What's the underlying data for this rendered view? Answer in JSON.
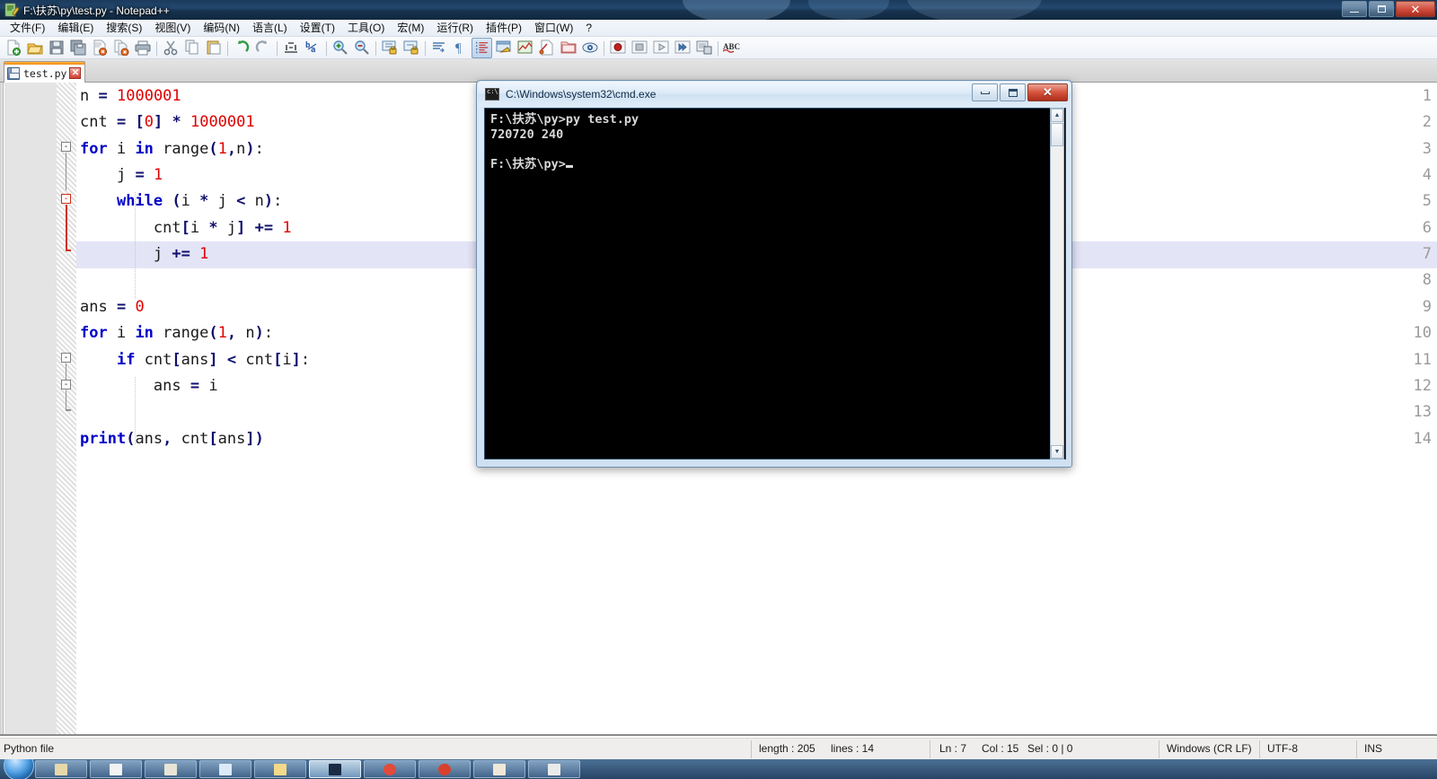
{
  "window": {
    "title": "F:\\扶苏\\py\\test.py - Notepad++",
    "icon": "notepad-plus-plus-icon",
    "minimize_label": "─",
    "maximize_label": "❐",
    "close_label": "✕"
  },
  "menu": {
    "items": [
      {
        "label": "文件(F)",
        "name": "menu-file"
      },
      {
        "label": "编辑(E)",
        "name": "menu-edit"
      },
      {
        "label": "搜索(S)",
        "name": "menu-search"
      },
      {
        "label": "视图(V)",
        "name": "menu-view"
      },
      {
        "label": "编码(N)",
        "name": "menu-encoding"
      },
      {
        "label": "语言(L)",
        "name": "menu-language"
      },
      {
        "label": "设置(T)",
        "name": "menu-settings"
      },
      {
        "label": "工具(O)",
        "name": "menu-tools"
      },
      {
        "label": "宏(M)",
        "name": "menu-macro"
      },
      {
        "label": "运行(R)",
        "name": "menu-run"
      },
      {
        "label": "插件(P)",
        "name": "menu-plugins"
      },
      {
        "label": "窗口(W)",
        "name": "menu-window"
      },
      {
        "label": "?",
        "name": "menu-help"
      }
    ]
  },
  "toolbar": {
    "buttons": [
      {
        "icon": "new-file-icon"
      },
      {
        "icon": "open-file-icon"
      },
      {
        "icon": "save-icon"
      },
      {
        "icon": "save-all-icon"
      },
      {
        "icon": "close-file-icon"
      },
      {
        "icon": "close-all-icon"
      },
      {
        "icon": "print-icon"
      },
      {
        "icon": "separator"
      },
      {
        "icon": "cut-icon"
      },
      {
        "icon": "copy-icon"
      },
      {
        "icon": "paste-icon"
      },
      {
        "icon": "separator"
      },
      {
        "icon": "undo-icon"
      },
      {
        "icon": "redo-icon"
      },
      {
        "icon": "separator"
      },
      {
        "icon": "find-icon"
      },
      {
        "icon": "replace-icon"
      },
      {
        "icon": "separator"
      },
      {
        "icon": "zoom-in-icon"
      },
      {
        "icon": "zoom-out-icon"
      },
      {
        "icon": "separator"
      },
      {
        "icon": "sync-vertical-scroll-icon"
      },
      {
        "icon": "sync-horizontal-scroll-icon"
      },
      {
        "icon": "separator"
      },
      {
        "icon": "word-wrap-icon"
      },
      {
        "icon": "show-all-characters-icon"
      },
      {
        "icon": "indent-guide-icon",
        "state": "pressed"
      },
      {
        "icon": "user-defined-dialog-icon"
      },
      {
        "icon": "document-map-icon"
      },
      {
        "icon": "function-list-icon"
      },
      {
        "icon": "folder-as-workspace-icon"
      },
      {
        "icon": "monitoring-icon"
      },
      {
        "icon": "separator"
      },
      {
        "icon": "record-macro-icon"
      },
      {
        "icon": "stop-recording-icon"
      },
      {
        "icon": "play-macro-icon"
      },
      {
        "icon": "run-macro-multiple-icon"
      },
      {
        "icon": "save-macro-icon"
      },
      {
        "icon": "separator"
      },
      {
        "icon": "spell-check-icon"
      }
    ]
  },
  "tabs": [
    {
      "label": "test.py",
      "icon": "saved-file-icon",
      "close": "✕",
      "active": true
    }
  ],
  "editor": {
    "lines": [
      {
        "n": "1",
        "indent": 0,
        "tokens": [
          {
            "t": "n",
            "c": "plain"
          },
          {
            "t": " ",
            "c": "plain"
          },
          {
            "t": "=",
            "c": "op"
          },
          {
            "t": " ",
            "c": "plain"
          },
          {
            "t": "1000001",
            "c": "num"
          }
        ]
      },
      {
        "n": "2",
        "indent": 0,
        "tokens": [
          {
            "t": "cnt",
            "c": "plain"
          },
          {
            "t": " ",
            "c": "plain"
          },
          {
            "t": "=",
            "c": "op"
          },
          {
            "t": " ",
            "c": "plain"
          },
          {
            "t": "[",
            "c": "brk"
          },
          {
            "t": "0",
            "c": "num"
          },
          {
            "t": "]",
            "c": "brk"
          },
          {
            "t": " ",
            "c": "plain"
          },
          {
            "t": "*",
            "c": "op"
          },
          {
            "t": " ",
            "c": "plain"
          },
          {
            "t": "1000001",
            "c": "num"
          }
        ]
      },
      {
        "n": "3",
        "indent": 0,
        "tokens": [
          {
            "t": "for",
            "c": "kw"
          },
          {
            "t": " i ",
            "c": "plain"
          },
          {
            "t": "in",
            "c": "kw"
          },
          {
            "t": " range",
            "c": "plain"
          },
          {
            "t": "(",
            "c": "brk"
          },
          {
            "t": "1",
            "c": "num"
          },
          {
            "t": ",",
            "c": "brk"
          },
          {
            "t": "n",
            "c": "plain"
          },
          {
            "t": ")",
            "c": "brk"
          },
          {
            "t": ":",
            "c": "plain"
          }
        ]
      },
      {
        "n": "4",
        "indent": 4,
        "tokens": [
          {
            "t": "j",
            "c": "plain"
          },
          {
            "t": " ",
            "c": "plain"
          },
          {
            "t": "=",
            "c": "op"
          },
          {
            "t": " ",
            "c": "plain"
          },
          {
            "t": "1",
            "c": "num"
          }
        ]
      },
      {
        "n": "5",
        "indent": 4,
        "tokens": [
          {
            "t": "while",
            "c": "kw"
          },
          {
            "t": " ",
            "c": "plain"
          },
          {
            "t": "(",
            "c": "brk"
          },
          {
            "t": "i ",
            "c": "plain"
          },
          {
            "t": "*",
            "c": "op"
          },
          {
            "t": " j ",
            "c": "plain"
          },
          {
            "t": "<",
            "c": "op"
          },
          {
            "t": " n",
            "c": "plain"
          },
          {
            "t": ")",
            "c": "brk"
          },
          {
            "t": ":",
            "c": "plain"
          }
        ]
      },
      {
        "n": "6",
        "indent": 8,
        "tokens": [
          {
            "t": "cnt",
            "c": "plain"
          },
          {
            "t": "[",
            "c": "brk"
          },
          {
            "t": "i ",
            "c": "plain"
          },
          {
            "t": "*",
            "c": "op"
          },
          {
            "t": " j",
            "c": "plain"
          },
          {
            "t": "]",
            "c": "brk"
          },
          {
            "t": " ",
            "c": "plain"
          },
          {
            "t": "+=",
            "c": "op"
          },
          {
            "t": " ",
            "c": "plain"
          },
          {
            "t": "1",
            "c": "num"
          }
        ]
      },
      {
        "n": "7",
        "indent": 8,
        "highlight": true,
        "tokens": [
          {
            "t": "j",
            "c": "plain"
          },
          {
            "t": " ",
            "c": "plain"
          },
          {
            "t": "+=",
            "c": "op"
          },
          {
            "t": " ",
            "c": "plain"
          },
          {
            "t": "1",
            "c": "num"
          }
        ]
      },
      {
        "n": "8",
        "indent": 0,
        "tokens": []
      },
      {
        "n": "9",
        "indent": 0,
        "tokens": [
          {
            "t": "ans",
            "c": "plain"
          },
          {
            "t": " ",
            "c": "plain"
          },
          {
            "t": "=",
            "c": "op"
          },
          {
            "t": " ",
            "c": "plain"
          },
          {
            "t": "0",
            "c": "num"
          }
        ]
      },
      {
        "n": "10",
        "indent": 0,
        "tokens": [
          {
            "t": "for",
            "c": "kw"
          },
          {
            "t": " i ",
            "c": "plain"
          },
          {
            "t": "in",
            "c": "kw"
          },
          {
            "t": " range",
            "c": "plain"
          },
          {
            "t": "(",
            "c": "brk"
          },
          {
            "t": "1",
            "c": "num"
          },
          {
            "t": ",",
            "c": "brk"
          },
          {
            "t": " n",
            "c": "plain"
          },
          {
            "t": ")",
            "c": "brk"
          },
          {
            "t": ":",
            "c": "plain"
          }
        ]
      },
      {
        "n": "11",
        "indent": 4,
        "tokens": [
          {
            "t": "if",
            "c": "kw"
          },
          {
            "t": " cnt",
            "c": "plain"
          },
          {
            "t": "[",
            "c": "brk"
          },
          {
            "t": "ans",
            "c": "plain"
          },
          {
            "t": "]",
            "c": "brk"
          },
          {
            "t": " ",
            "c": "plain"
          },
          {
            "t": "<",
            "c": "op"
          },
          {
            "t": " cnt",
            "c": "plain"
          },
          {
            "t": "[",
            "c": "brk"
          },
          {
            "t": "i",
            "c": "plain"
          },
          {
            "t": "]",
            "c": "brk"
          },
          {
            "t": ":",
            "c": "plain"
          }
        ]
      },
      {
        "n": "12",
        "indent": 8,
        "tokens": [
          {
            "t": "ans",
            "c": "plain"
          },
          {
            "t": " ",
            "c": "plain"
          },
          {
            "t": "=",
            "c": "op"
          },
          {
            "t": " i",
            "c": "plain"
          }
        ]
      },
      {
        "n": "13",
        "indent": 0,
        "tokens": []
      },
      {
        "n": "14",
        "indent": 0,
        "tokens": [
          {
            "t": "print",
            "c": "fn"
          },
          {
            "t": "(",
            "c": "brk"
          },
          {
            "t": "ans",
            "c": "plain"
          },
          {
            "t": ",",
            "c": "brk"
          },
          {
            "t": " cnt",
            "c": "plain"
          },
          {
            "t": "[",
            "c": "brk"
          },
          {
            "t": "ans",
            "c": "plain"
          },
          {
            "t": "]",
            "c": "brk"
          },
          {
            "t": ")",
            "c": "brk"
          }
        ]
      }
    ],
    "fold_markers": [
      {
        "line": 3,
        "glyph": "-",
        "color": "gray"
      },
      {
        "line": 5,
        "glyph": "-",
        "color": "red"
      },
      {
        "line": 10,
        "glyph": "-",
        "color": "gray"
      },
      {
        "line": 11,
        "glyph": "-",
        "color": "gray"
      }
    ],
    "colors": {
      "keyword": "#0000c8",
      "number": "#e00000",
      "operator": "#10106e",
      "current_line_highlight": "#e4e4f7",
      "line_number": "#9a9a9a",
      "background": "#ffffff"
    }
  },
  "cmd": {
    "title": "C:\\Windows\\system32\\cmd.exe",
    "icon": "cmd-console-icon",
    "minimize_label": "minimize",
    "maximize_label": "maximize",
    "close_label": "✕",
    "lines": [
      "F:\\扶苏\\py>py test.py",
      "720720 240",
      "",
      "F:\\扶苏\\py>"
    ],
    "scroll_up": "▲",
    "scroll_down": "▼"
  },
  "status": {
    "doc_type": "Python file",
    "length_label": "length : 205",
    "lines_label": "lines : 14",
    "ln": "Ln : 7",
    "col": "Col : 15",
    "sel": "Sel : 0 | 0",
    "eol": "Windows (CR LF)",
    "encoding": "UTF-8",
    "insert_mode": "INS"
  },
  "taskbar": {
    "start_label": "start-orb",
    "items": [
      {
        "name": "taskbar-item-1",
        "color": "#e8d7a8"
      },
      {
        "name": "taskbar-item-2",
        "color": "#f2f2f2"
      },
      {
        "name": "taskbar-item-3",
        "color": "#e9e4d6"
      },
      {
        "name": "taskbar-item-4",
        "color": "#dceaf8"
      },
      {
        "name": "taskbar-item-5",
        "color": "#f4d98a"
      },
      {
        "name": "taskbar-item-6",
        "color": "#1b2b44",
        "active": true
      },
      {
        "name": "taskbar-item-7",
        "color": "#e24a3a"
      },
      {
        "name": "taskbar-item-8",
        "color": "#d8402e"
      },
      {
        "name": "taskbar-item-9",
        "color": "#efe8d8"
      },
      {
        "name": "taskbar-item-10",
        "color": "#eaeaea"
      }
    ]
  }
}
